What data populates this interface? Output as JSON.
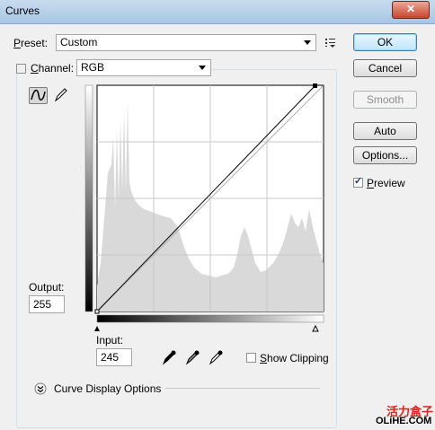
{
  "window": {
    "title": "Curves",
    "close_glyph": "✕"
  },
  "preset": {
    "label_u": "P",
    "label_rest": "reset:",
    "value": "Custom"
  },
  "channel": {
    "label_u": "C",
    "label_rest": "hannel:",
    "value": "RGB"
  },
  "buttons": {
    "ok": "OK",
    "cancel": "Cancel",
    "smooth": "Smooth",
    "auto": "Auto",
    "options": "Options..."
  },
  "preview": {
    "label_u": "P",
    "label_rest": "review",
    "checked": true
  },
  "output": {
    "label": "Output:",
    "value": "255"
  },
  "input": {
    "label": "Input:",
    "value": "245"
  },
  "show_clipping": {
    "label_u": "S",
    "label_rest": "how Clipping",
    "checked": false
  },
  "curve_display_options": {
    "label": "Curve Display Options"
  },
  "watermark": {
    "cn": "活力盒子",
    "en": "OLiHE.COM"
  },
  "colors": {
    "histogram": "#d9d9d9",
    "grid": "#c8c8c8",
    "ok_border": "#3c7fb1",
    "watermark_red": "#e0201a"
  }
}
